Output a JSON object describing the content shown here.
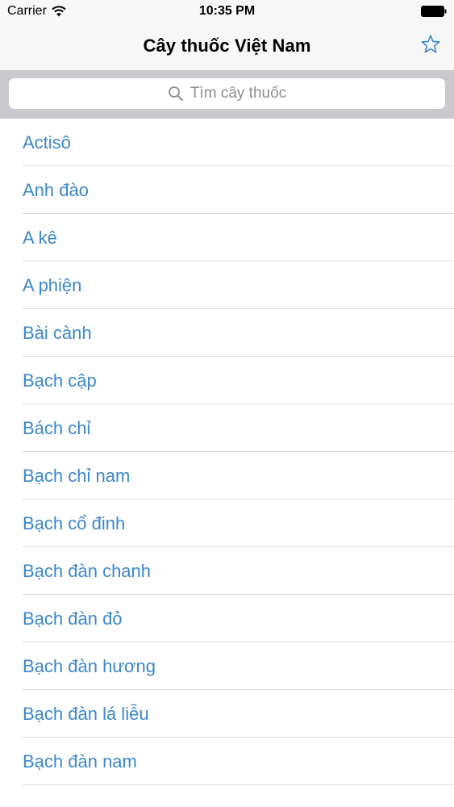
{
  "status_bar": {
    "carrier": "Carrier",
    "time": "10:35 PM"
  },
  "nav": {
    "title": "Cây thuốc Việt Nam",
    "favorite_icon": "star-icon"
  },
  "search": {
    "placeholder": "Tìm cây thuốc"
  },
  "list": {
    "items": [
      {
        "label": "Actisô"
      },
      {
        "label": "Anh đào"
      },
      {
        "label": "A kê"
      },
      {
        "label": "A phiện"
      },
      {
        "label": "Bài cành"
      },
      {
        "label": "Bạch cập"
      },
      {
        "label": "Bách chỉ"
      },
      {
        "label": "Bạch chỉ nam"
      },
      {
        "label": "Bạch cổ đinh"
      },
      {
        "label": "Bạch đàn chanh"
      },
      {
        "label": "Bạch đàn đỏ"
      },
      {
        "label": "Bạch đàn hương"
      },
      {
        "label": "Bạch đàn lá liễu"
      },
      {
        "label": "Bạch đàn nam"
      }
    ]
  },
  "colors": {
    "accent": "#3b87cc",
    "bar_background": "#f7f7f7",
    "search_background": "#c9c9ce"
  }
}
